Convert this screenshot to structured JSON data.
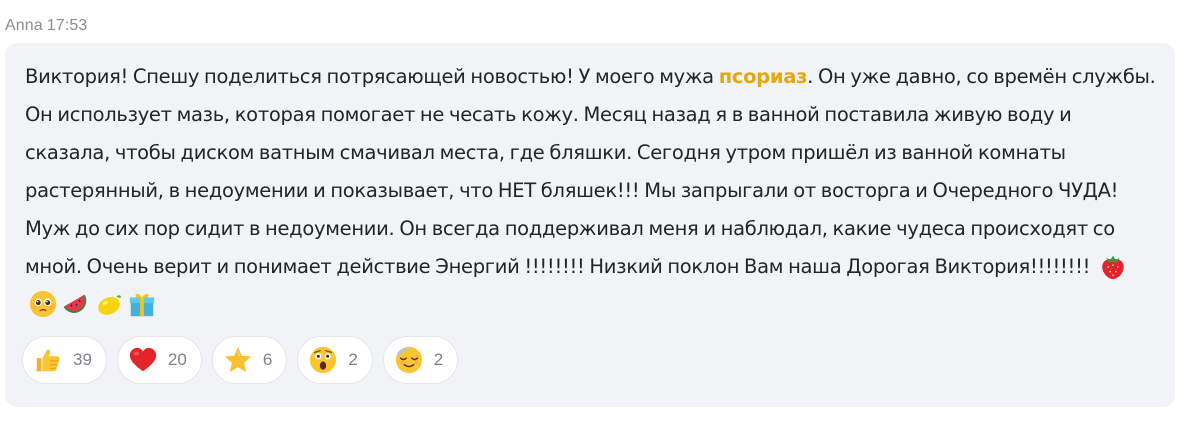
{
  "message": {
    "author": "Anna",
    "time": "17:53",
    "text_before": "Виктория! Спешу поделиться потрясающей новостью! У моего мужа ",
    "highlight": "псориаз",
    "text_after": ". Он уже давно, со времён службы. Он использует мазь, которая помогает не чесать кожу. Месяц назад я в ванной поставила живую воду и сказала, чтобы диском ватным смачивал места, где бляшки. Сегодня утром пришёл из ванной комнаты растерянный, в недоумении и показывает, что НЕТ бляшек!!! Мы запрыгали от восторга и Очередного ЧУДА! Муж до сих пор сидит в недоумении. Он всегда поддерживал меня и наблюдал, какие чудеса происходят со мной. Очень верит и понимает действие Энергий !!!!!!!! Низкий поклон Вам наша Дорогая Виктория!!!!!!!! ",
    "highlight_color": "#e5a712",
    "emojis": [
      "strawberry-icon",
      "pleading-face-icon",
      "watermelon-icon",
      "lemon-icon",
      "gift-icon"
    ]
  },
  "reactions": [
    {
      "icon": "thumbs-up-icon",
      "count": "39"
    },
    {
      "icon": "heart-icon",
      "count": "20"
    },
    {
      "icon": "star-icon",
      "count": "6"
    },
    {
      "icon": "astonished-face-icon",
      "count": "2"
    },
    {
      "icon": "relieved-face-icon",
      "count": "2"
    }
  ],
  "colors": {
    "bubble_bg": "#f1f3f6",
    "meta_text": "#8a8f96",
    "message_text": "#222426",
    "count_text": "#7d838a"
  }
}
